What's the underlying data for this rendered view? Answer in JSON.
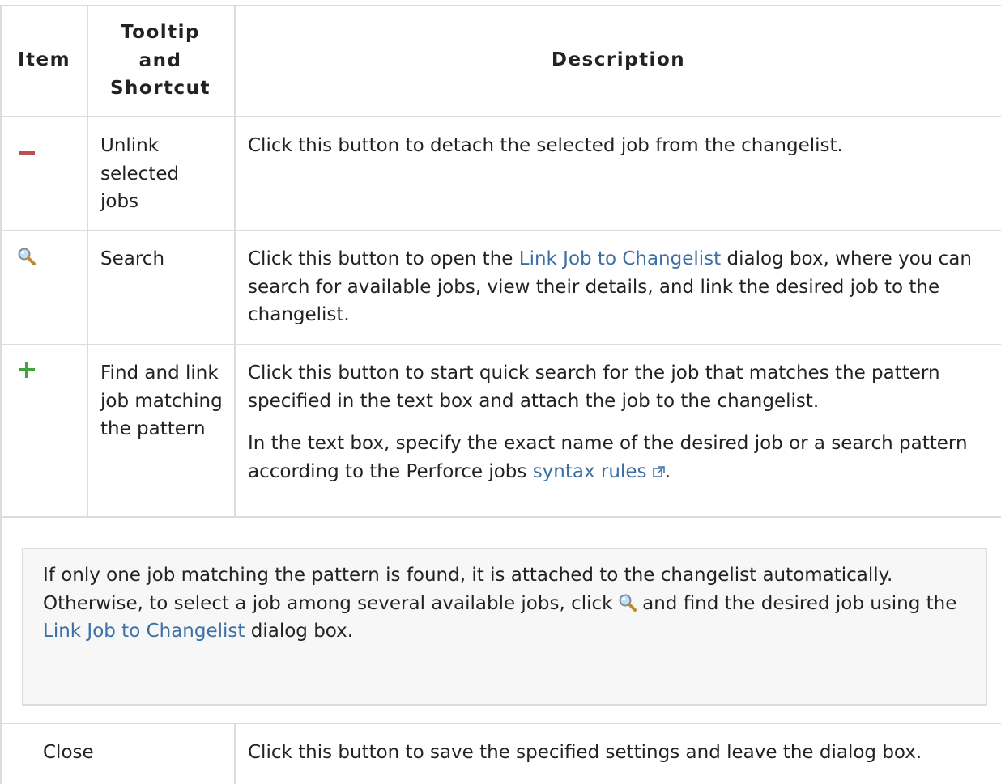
{
  "table": {
    "headers": {
      "item": "Item",
      "tooltip": "Tooltip and Shortcut",
      "description": "Description"
    },
    "rows": [
      {
        "icon": "minus-icon",
        "icon_color": "#c0504d",
        "tooltip": "Unlink selected jobs",
        "description": "Click this button to detach the selected job from the changelist."
      },
      {
        "icon": "search-icon",
        "tooltip": "Search",
        "description_prefix": "Click this button to open the ",
        "description_link": "Link Job to Changelist",
        "description_suffix": " dialog box, where you can search for available jobs, view their details, and link the desired job to the changelist."
      },
      {
        "icon": "plus-icon",
        "icon_color": "#3fa63f",
        "tooltip": "Find and link job matching the pattern",
        "description_1": "Click this button to start quick search for the job that matches the pattern specified in the text box and attach the job to the changelist.",
        "description_2_prefix": "In the text box, specify the exact name of the desired job or a search pattern according to the Perforce jobs ",
        "description_2_link": "syntax rules",
        "description_2_suffix": "."
      }
    ],
    "note": {
      "prefix": "If only one job matching the pattern is found, it is attached to the changelist automatically. Otherwise, to select a job among several available jobs, click ",
      "icon": "search-icon",
      "middle": " and find the desired job using the ",
      "link": "Link Job to Changelist",
      "suffix": " dialog box."
    },
    "close_row": {
      "item": "Close",
      "description": "Click this button to save the specified settings and leave the dialog box."
    }
  },
  "colors": {
    "link": "#3b6fa6",
    "grid": "#dcdcdc",
    "note_bg": "#f7f7f7"
  }
}
